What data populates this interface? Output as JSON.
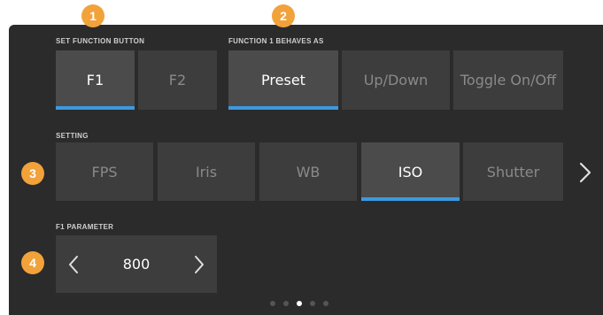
{
  "callouts": [
    "1",
    "2",
    "3",
    "4"
  ],
  "set_function": {
    "label": "SET FUNCTION BUTTON",
    "buttons": [
      {
        "label": "F1",
        "active": true
      },
      {
        "label": "F2",
        "active": false
      }
    ]
  },
  "behaves_as": {
    "label": "FUNCTION 1 BEHAVES AS",
    "buttons": [
      {
        "label": "Preset",
        "active": true
      },
      {
        "label": "Up/Down",
        "active": false
      },
      {
        "label": "Toggle On/Off",
        "active": false
      }
    ]
  },
  "setting": {
    "label": "SETTING",
    "buttons": [
      {
        "label": "FPS",
        "active": false
      },
      {
        "label": "Iris",
        "active": false
      },
      {
        "label": "WB",
        "active": false
      },
      {
        "label": "ISO",
        "active": true
      },
      {
        "label": "Shutter",
        "active": false
      }
    ],
    "next_icon": "chevron-right-icon"
  },
  "parameter": {
    "label": "F1 PARAMETER",
    "value": "800",
    "prev_icon": "chevron-left-icon",
    "next_icon": "chevron-right-icon"
  },
  "pagination": {
    "count": 5,
    "active_index": 2
  },
  "colors": {
    "accent": "#3a9ae0",
    "callout": "#f2a23a",
    "panel": "#2b2b2b",
    "button": "#3d3d3d",
    "button_active": "#4b4b4b"
  }
}
